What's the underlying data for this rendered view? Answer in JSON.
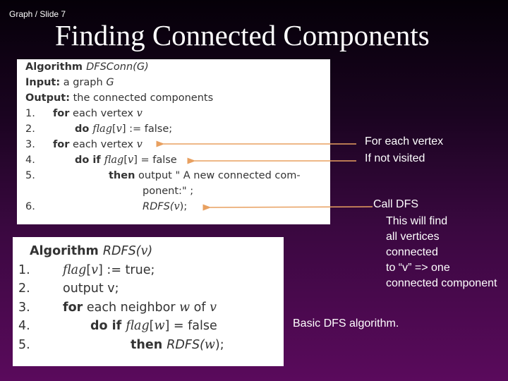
{
  "slide": {
    "breadcrumb": "Graph / Slide 7",
    "title": "Finding Connected Components"
  },
  "accent_color": "#e8a060",
  "algo1": {
    "lines": [
      {
        "num": "",
        "indent": 0,
        "segs": [
          {
            "t": "Algorithm ",
            "s": "b"
          },
          {
            "t": "DFSConn(G)",
            "s": "i"
          }
        ]
      },
      {
        "num": "",
        "indent": 0,
        "segs": [
          {
            "t": "Input:",
            "s": "b"
          },
          {
            "t": " a graph ",
            "s": "n"
          },
          {
            "t": "G",
            "s": "i"
          }
        ]
      },
      {
        "num": "",
        "indent": 0,
        "segs": [
          {
            "t": "Output:",
            "s": "b"
          },
          {
            "t": " the connected components",
            "s": "n"
          }
        ]
      },
      {
        "num": "1.",
        "indent": 1,
        "segs": [
          {
            "t": "for",
            "s": "b"
          },
          {
            "t": " each vertex ",
            "s": "n"
          },
          {
            "t": "v",
            "s": "m"
          }
        ]
      },
      {
        "num": "2.",
        "indent": 2,
        "segs": [
          {
            "t": "do ",
            "s": "b"
          },
          {
            "t": "flag",
            "s": "m"
          },
          {
            "t": "[",
            "s": "n"
          },
          {
            "t": "v",
            "s": "m"
          },
          {
            "t": "] := false;",
            "s": "n"
          }
        ]
      },
      {
        "num": "3.",
        "indent": 1,
        "segs": [
          {
            "t": "for",
            "s": "b"
          },
          {
            "t": " each vertex ",
            "s": "n"
          },
          {
            "t": "v",
            "s": "m"
          }
        ]
      },
      {
        "num": "4.",
        "indent": 2,
        "segs": [
          {
            "t": "do if ",
            "s": "b"
          },
          {
            "t": "flag",
            "s": "m"
          },
          {
            "t": "[",
            "s": "n"
          },
          {
            "t": "v",
            "s": "m"
          },
          {
            "t": "] = false",
            "s": "n"
          }
        ]
      },
      {
        "num": "5.",
        "indent": 3,
        "segs": [
          {
            "t": "then",
            "s": "b"
          },
          {
            "t": " output \" A new connected com-",
            "s": "n"
          }
        ]
      },
      {
        "num": "",
        "indent": 4,
        "segs": [
          {
            "t": "ponent:\" ;",
            "s": "n"
          }
        ]
      },
      {
        "num": "6.",
        "indent": 4,
        "segs": [
          {
            "t": "RDFS(",
            "s": "i"
          },
          {
            "t": "v",
            "s": "m"
          },
          {
            "t": ");",
            "s": "n"
          }
        ]
      }
    ]
  },
  "algo2": {
    "lines": [
      {
        "num": "",
        "indent": 0,
        "segs": [
          {
            "t": "Algorithm ",
            "s": "b"
          },
          {
            "t": "RDFS(",
            "s": "i"
          },
          {
            "t": "v",
            "s": "m"
          },
          {
            "t": ")",
            "s": "i"
          }
        ]
      },
      {
        "num": "1.",
        "indent": 1,
        "segs": [
          {
            "t": "flag",
            "s": "m"
          },
          {
            "t": "[",
            "s": "n"
          },
          {
            "t": "v",
            "s": "m"
          },
          {
            "t": "] := true;",
            "s": "n"
          }
        ]
      },
      {
        "num": "2.",
        "indent": 1,
        "segs": [
          {
            "t": "output v;",
            "s": "n"
          }
        ]
      },
      {
        "num": "3.",
        "indent": 1,
        "segs": [
          {
            "t": "for",
            "s": "b"
          },
          {
            "t": " each neighbor ",
            "s": "n"
          },
          {
            "t": "w",
            "s": "m"
          },
          {
            "t": " of ",
            "s": "n"
          },
          {
            "t": "v",
            "s": "m"
          }
        ]
      },
      {
        "num": "4.",
        "indent": 2,
        "segs": [
          {
            "t": "do if ",
            "s": "b"
          },
          {
            "t": "flag",
            "s": "m"
          },
          {
            "t": "[",
            "s": "n"
          },
          {
            "t": "w",
            "s": "m"
          },
          {
            "t": "] = false",
            "s": "n"
          }
        ]
      },
      {
        "num": "5.",
        "indent": 3,
        "segs": [
          {
            "t": "then ",
            "s": "b"
          },
          {
            "t": "RDFS(",
            "s": "i"
          },
          {
            "t": "w",
            "s": "m"
          },
          {
            "t": ");",
            "s": "n"
          }
        ]
      }
    ]
  },
  "notes": {
    "for_each": "For each vertex",
    "not_visited": "If not visited",
    "call_dfs": "Call DFS",
    "explain": [
      "This will find",
      "all vertices",
      "connected",
      "to “v” => one",
      "connected component"
    ],
    "basic": "Basic DFS algorithm."
  }
}
